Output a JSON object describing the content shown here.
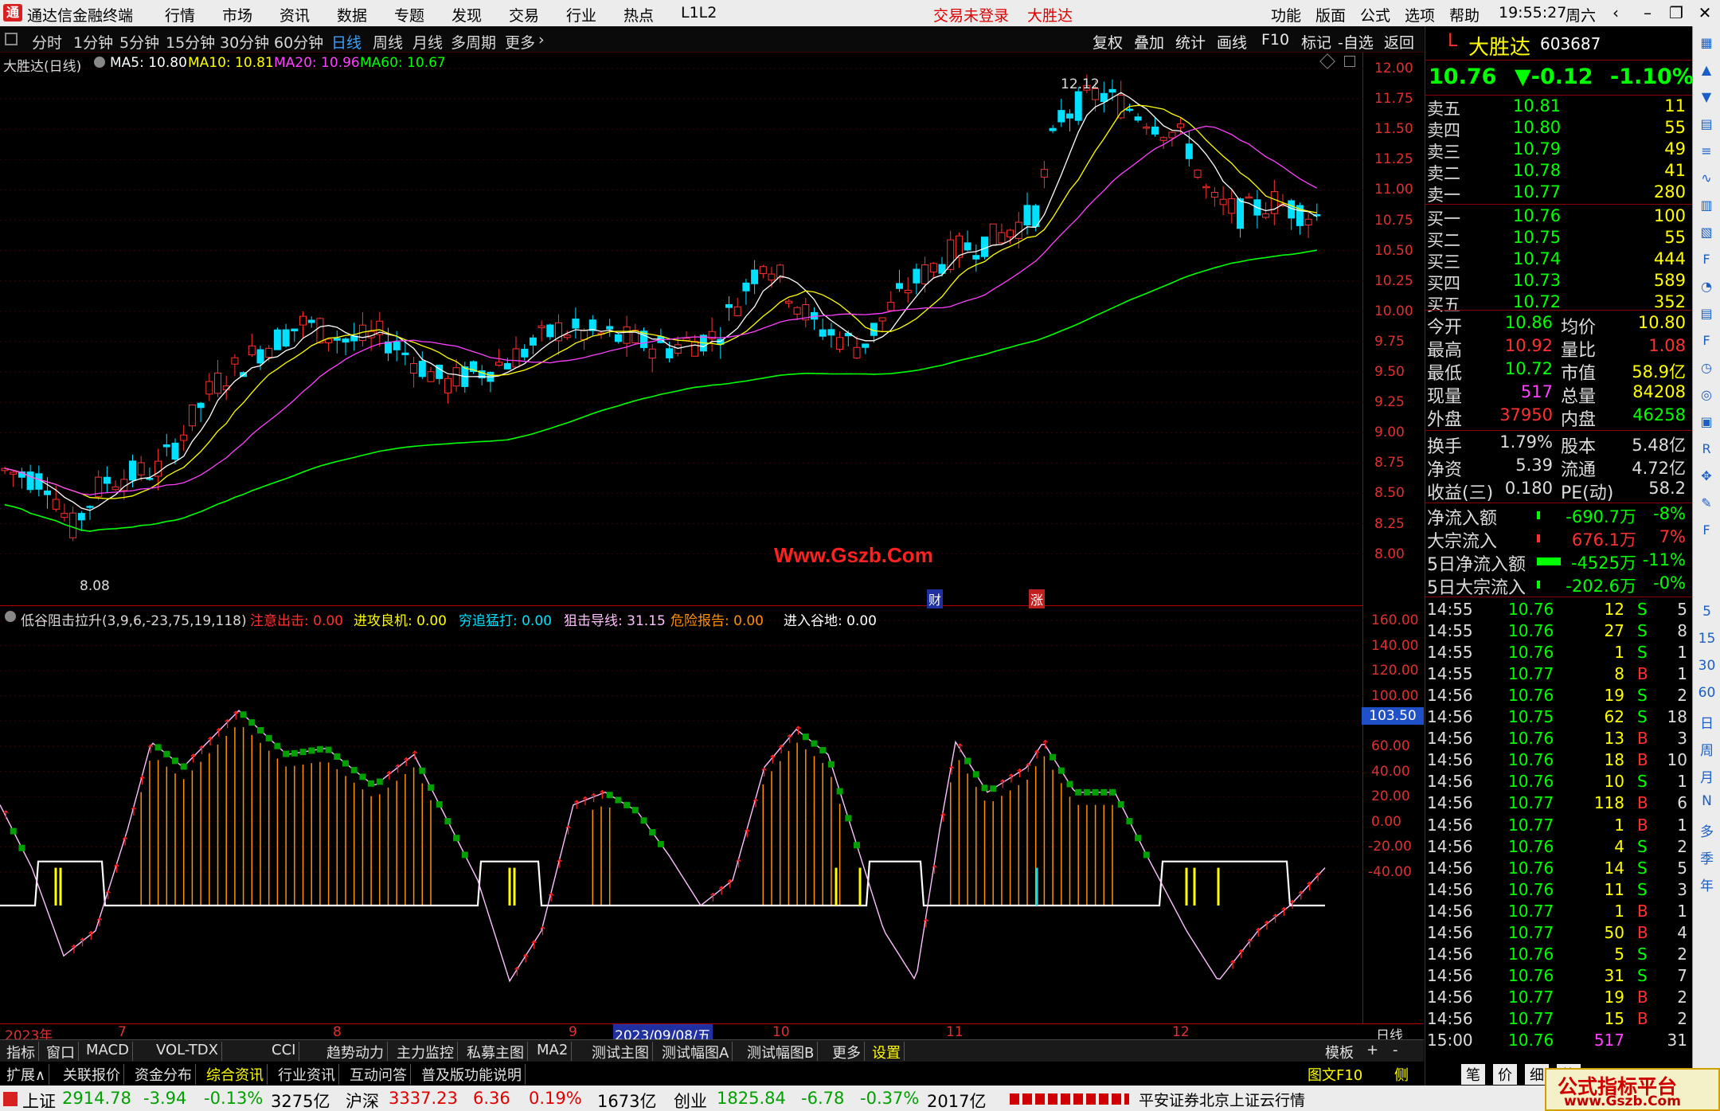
{
  "app": {
    "title": "通达信金融终端",
    "menu": [
      "行情",
      "市场",
      "资讯",
      "数据",
      "专题",
      "发现",
      "交易",
      "行业",
      "热点",
      "L1L2"
    ],
    "login_status": "交易未登录",
    "stock_name_menu": "大胜达",
    "right_menu": [
      "功能",
      "版面",
      "公式",
      "选项",
      "帮助"
    ],
    "time": "19:55:27",
    "weekday": "周六"
  },
  "period_bar": {
    "items": [
      "分时",
      "1分钟",
      "5分钟",
      "15分钟",
      "30分钟",
      "60分钟",
      "日线",
      "周线",
      "月线",
      "多周期",
      "更多"
    ],
    "active": "日线",
    "right_buttons": [
      "复权",
      "叠加",
      "统计",
      "画线",
      "F10",
      "标记",
      "-自选",
      "返回"
    ]
  },
  "kchart": {
    "title": "大胜达(日线)",
    "ma": [
      {
        "label": "MA5: 10.80",
        "color": "#ffffff"
      },
      {
        "label": "MA10: 10.81",
        "color": "#ffff00"
      },
      {
        "label": "MA20: 10.96",
        "color": "#ff00ff"
      },
      {
        "label": "MA60: 10.67",
        "color": "#00ff00"
      }
    ],
    "y_ticks": [
      "12.00",
      "11.75",
      "11.50",
      "11.25",
      "11.00",
      "10.75",
      "10.50",
      "10.25",
      "10.00",
      "9.75",
      "9.50",
      "9.25",
      "9.00",
      "8.75",
      "8.50",
      "8.25",
      "8.00"
    ],
    "high_label": "12.12",
    "low_label": "8.08",
    "watermark": "Www.Gszb.Com",
    "markers": [
      "财",
      "涨"
    ]
  },
  "indicator": {
    "name": "低谷阻击拉升(3,9,6,-23,75,19,118)",
    "lines": [
      {
        "label": "注意出击: 0.00",
        "color": "#ff3030"
      },
      {
        "label": "进攻良机: 0.00",
        "color": "#ffff00"
      },
      {
        "label": "穷追猛打: 0.00",
        "color": "#00e0ff"
      },
      {
        "label": "狙击导线: 31.15",
        "color": "#ffc0ff"
      },
      {
        "label": "危险报告: 0.00",
        "color": "#ff9000"
      },
      {
        "label": "进入谷地: 0.00",
        "color": "#ffffff"
      }
    ],
    "y_ticks": [
      "160.00",
      "140.00",
      "120.00",
      "100.00",
      "80.00",
      "60.00",
      "40.00",
      "20.00",
      "0.00",
      "-20.00",
      "-40.00"
    ],
    "current_tag": "103.50"
  },
  "x_axis": {
    "labels": [
      "2023年",
      "7",
      "8",
      "9",
      "2023/09/08/五",
      "10",
      "11",
      "12"
    ],
    "period": "日线"
  },
  "quote": {
    "market_flag": "L",
    "name": "大胜达",
    "code": "603687",
    "price": "10.76",
    "change": "▼-0.12",
    "pct": "-1.10%",
    "asks": [
      {
        "label": "卖五",
        "price": "10.81",
        "vol": "11"
      },
      {
        "label": "卖四",
        "price": "10.80",
        "vol": "55"
      },
      {
        "label": "卖三",
        "price": "10.79",
        "vol": "49"
      },
      {
        "label": "卖二",
        "price": "10.78",
        "vol": "41"
      },
      {
        "label": "卖一",
        "price": "10.77",
        "vol": "280"
      }
    ],
    "bids": [
      {
        "label": "买一",
        "price": "10.76",
        "vol": "100"
      },
      {
        "label": "买二",
        "price": "10.75",
        "vol": "55"
      },
      {
        "label": "买三",
        "price": "10.74",
        "vol": "444"
      },
      {
        "label": "买四",
        "price": "10.73",
        "vol": "589"
      },
      {
        "label": "买五",
        "price": "10.72",
        "vol": "352"
      }
    ],
    "stats": [
      [
        "今开",
        "10.86",
        "均价",
        "10.80"
      ],
      [
        "最高",
        "10.92",
        "量比",
        "1.08"
      ],
      [
        "最低",
        "10.72",
        "市值",
        "58.9亿"
      ],
      [
        "现量",
        "517",
        "总量",
        "84208"
      ],
      [
        "外盘",
        "37950",
        "内盘",
        "46258"
      ]
    ],
    "stats2": [
      [
        "换手",
        "1.79%",
        "股本",
        "5.48亿"
      ],
      [
        "净资",
        "5.39",
        "流通",
        "4.72亿"
      ],
      [
        "收益(三)",
        "0.180",
        "PE(动)",
        "58.2"
      ]
    ],
    "flows": [
      {
        "label": "净流入额",
        "value": "-690.7万",
        "pct": "-8%"
      },
      {
        "label": "大宗流入",
        "value": "676.1万",
        "pct": "7%"
      },
      {
        "label": "5日净流入额",
        "value": "-4525万",
        "pct": "-11%"
      },
      {
        "label": "5日大宗流入",
        "value": "-202.6万",
        "pct": "-0%"
      }
    ],
    "ticks": [
      [
        "14:55",
        "10.76",
        "12",
        "S",
        "5"
      ],
      [
        "14:55",
        "10.76",
        "27",
        "S",
        "8"
      ],
      [
        "14:55",
        "10.76",
        "1",
        "S",
        "1"
      ],
      [
        "14:55",
        "10.77",
        "8",
        "B",
        "1"
      ],
      [
        "14:56",
        "10.76",
        "19",
        "S",
        "2"
      ],
      [
        "14:56",
        "10.75",
        "62",
        "S",
        "18"
      ],
      [
        "14:56",
        "10.76",
        "13",
        "B",
        "3"
      ],
      [
        "14:56",
        "10.76",
        "18",
        "B",
        "10"
      ],
      [
        "14:56",
        "10.76",
        "10",
        "S",
        "1"
      ],
      [
        "14:56",
        "10.77",
        "118",
        "B",
        "6"
      ],
      [
        "14:56",
        "10.77",
        "1",
        "B",
        "1"
      ],
      [
        "14:56",
        "10.76",
        "4",
        "S",
        "2"
      ],
      [
        "14:56",
        "10.76",
        "14",
        "S",
        "5"
      ],
      [
        "14:56",
        "10.76",
        "11",
        "S",
        "3"
      ],
      [
        "14:56",
        "10.77",
        "1",
        "B",
        "1"
      ],
      [
        "14:56",
        "10.77",
        "50",
        "B",
        "4"
      ],
      [
        "14:56",
        "10.76",
        "5",
        "S",
        "2"
      ],
      [
        "14:56",
        "10.76",
        "31",
        "S",
        "7"
      ],
      [
        "14:56",
        "10.77",
        "19",
        "B",
        "2"
      ],
      [
        "14:56",
        "10.77",
        "15",
        "B",
        "2"
      ],
      [
        "15:00",
        "10.76",
        "517",
        "",
        "31"
      ]
    ]
  },
  "sidebar_icons": [
    "dock-icon",
    "arrow-up-icon",
    "arrow-down-icon",
    "quote-icon",
    "list-icon",
    "chart-icon",
    "kline-icon",
    "doc-icon",
    "f10-icon",
    "flow-icon",
    "tick-icon",
    "fs-icon",
    "clock-icon",
    "ring-icon",
    "news-icon",
    "rsi-icon",
    "move-icon",
    "pen-icon",
    "fs2-icon"
  ],
  "sidebar_labels": [
    "5",
    "15",
    "30",
    "60",
    "日",
    "周",
    "月",
    "N",
    "多",
    "季",
    "年"
  ],
  "tabs": [
    "指标",
    "窗口",
    "MACD",
    "VOL-TDX",
    "CCI",
    "趋势动力",
    "主力监控",
    "私募主图",
    "MA2",
    "测试主图",
    "测试幅图A",
    "测试幅图B",
    "更多",
    "设置"
  ],
  "tabs_right": [
    "模板",
    "+",
    "-"
  ],
  "tabs2": [
    "扩展∧",
    "关联报价",
    "资金分布",
    "综合资讯",
    "行业资讯",
    "互动问答",
    "普及版功能说明"
  ],
  "tabs2_right": [
    "图文F10",
    "侧边栏《",
    "笔",
    "价",
    "细",
    "势"
  ],
  "status": {
    "items": [
      {
        "name": "上证",
        "value": "2914.78",
        "chg": "-3.94",
        "pct": "-0.13%",
        "amt": "3275亿"
      },
      {
        "name": "沪深",
        "value": "3337.23",
        "chg": "6.36",
        "pct": "0.19%",
        "amt": "1673亿"
      },
      {
        "name": "创业",
        "value": "1825.84",
        "chg": "-6.78",
        "pct": "-0.37%",
        "amt": "2017亿"
      }
    ],
    "server": "平安证券北京上证云行情",
    "brand": "公式指标平台",
    "brand_url": "www.Gszb.Com"
  }
}
